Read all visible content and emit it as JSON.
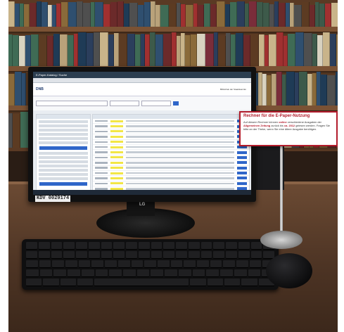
{
  "screen": {
    "browser_title": "E-Paper-Katalog / Suche",
    "app_logo": "DNB",
    "brand": "Bibliothek der Staatskanzlei"
  },
  "sign": {
    "title": "Rechner für die E-Paper-Nutzung",
    "body_1": "Auf diesem Rechner können ",
    "body_2": "online",
    "body_3": " verschiedene Ausgaben der ",
    "body_4": "Allgemeinen Zeitung",
    "body_5": " zurück bis ",
    "body_6": "ca. 2012",
    "body_7": " gelesen werden. Fragen Sie bitte an der Theke, wenn Sie eine ältere Ausgabe benötigen."
  },
  "tags": {
    "kdv": "KDV  0029174",
    "monitor_brand": "LG"
  },
  "colors": {
    "accent_red": "#b31c2c",
    "ui_blue": "#2f66c9",
    "highlight_yellow": "#f2e646"
  }
}
